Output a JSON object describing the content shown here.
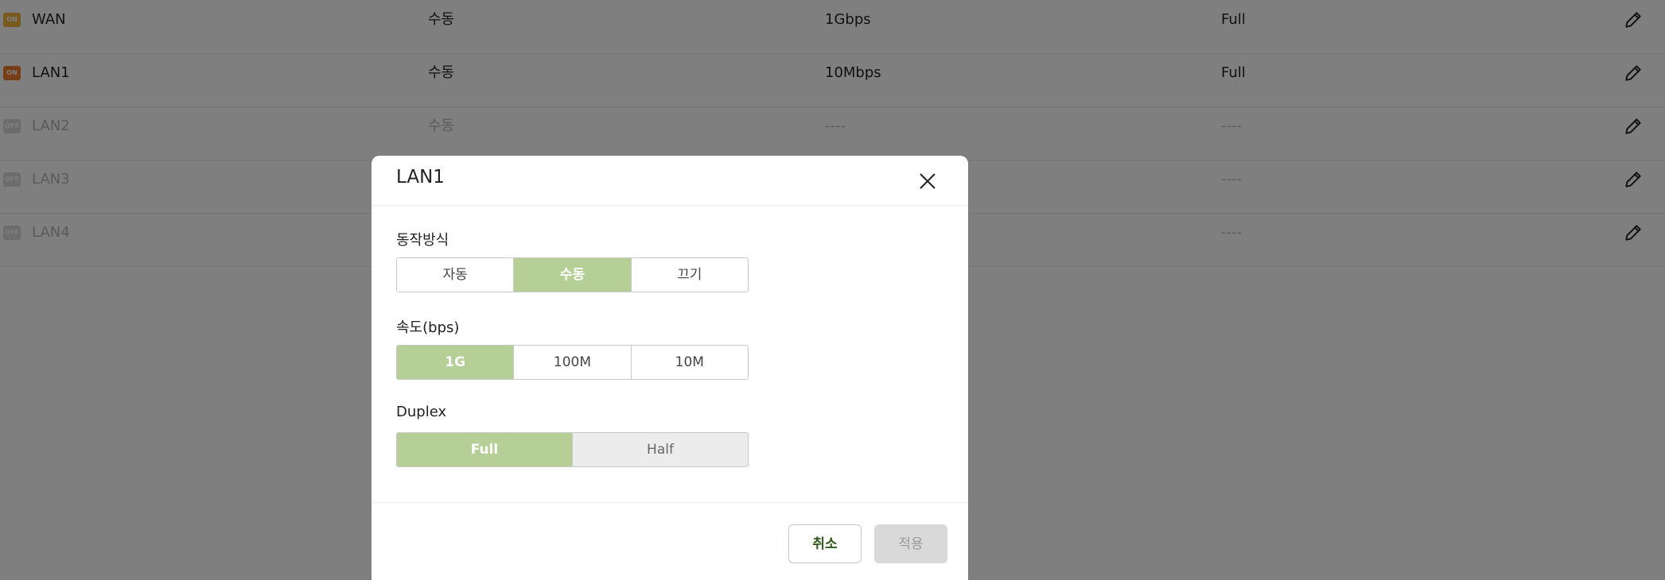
{
  "ports": [
    {
      "status": "ON",
      "name": "WAN",
      "mode": "수동",
      "speed": "1Gbps",
      "duplex": "Full"
    },
    {
      "status": "ON",
      "name": "LAN1",
      "mode": "수동",
      "speed": "10Mbps",
      "duplex": "Full"
    },
    {
      "status": "OFF",
      "name": "LAN2",
      "mode": "수동",
      "speed": "----",
      "duplex": "----"
    },
    {
      "status": "OFF",
      "name": "LAN3",
      "mode": "",
      "speed": "",
      "duplex": "----"
    },
    {
      "status": "OFF",
      "name": "LAN4",
      "mode": "",
      "speed": "",
      "duplex": "----"
    }
  ],
  "modal": {
    "title": "LAN1",
    "mode_label": "동작방식",
    "mode_options": [
      "자동",
      "수동",
      "끄기"
    ],
    "mode_selected": "수동",
    "speed_label": "속도(bps)",
    "speed_options": [
      "1G",
      "100M",
      "10M"
    ],
    "speed_selected": "1G",
    "duplex_label": "Duplex",
    "duplex_options": [
      "Full",
      "Half"
    ],
    "duplex_selected": "Full",
    "cancel_label": "취소",
    "apply_label": "적용"
  },
  "colors": {
    "accent": "#b5cf96",
    "status_on_wan": "#f0b43c",
    "status_on_lan": "#ee7a2d",
    "status_off": "#d8d8d8"
  }
}
